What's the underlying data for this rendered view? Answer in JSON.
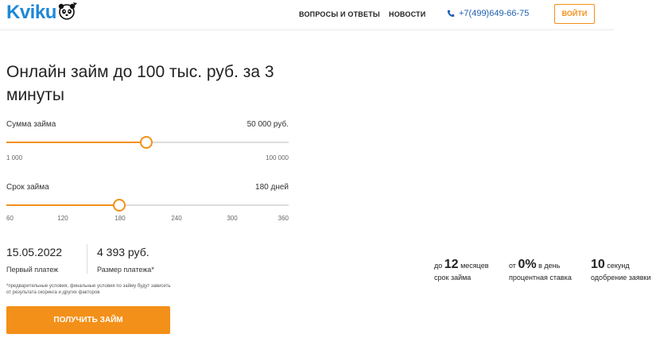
{
  "header": {
    "logo_text": "Kviku",
    "nav": [
      {
        "label": "ВОПРОСЫ И ОТВЕТЫ"
      },
      {
        "label": "НОВОСТИ"
      }
    ],
    "phone": "+7(499)649-66-75",
    "login_label": "ВОЙТИ"
  },
  "main": {
    "title": "Онлайн займ до 100 тыс. руб. за 3 минуты",
    "amount": {
      "label": "Сумма займа",
      "value_text": "50 000 руб.",
      "min_text": "1 000",
      "max_text": "100 000",
      "min": 1000,
      "max": 100000,
      "value": 50000
    },
    "term": {
      "label": "Срок займа",
      "value_text": "180 дней",
      "ticks": [
        "60",
        "120",
        "180",
        "240",
        "300",
        "360"
      ],
      "min": 60,
      "max": 360,
      "value": 180
    },
    "result": {
      "date": "15.05.2022",
      "date_caption": "Первый платеж",
      "payment": "4 393 руб.",
      "payment_caption": "Размер платежа*"
    },
    "disclaimer": "*предварительные условия, финальные условия по займу будут зависеть от результата скоринга и других факторов",
    "cta_label": "ПОЛУЧИТЬ ЗАЙМ"
  },
  "features": [
    {
      "prefix": "до",
      "big": "12",
      "suffix": "месяцев",
      "caption": "срок займа"
    },
    {
      "prefix": "от",
      "big": "0%",
      "suffix": "в день",
      "caption": "процентная ставка"
    },
    {
      "prefix": "",
      "big": "10",
      "suffix": "секунд",
      "caption": "одобрение заявки"
    }
  ],
  "colors": {
    "accent": "#f39019",
    "brand_blue": "#1e88d8",
    "phone_blue": "#1f5fb0",
    "track": "#dcdcdc"
  },
  "icons": [
    "panda-logo-icon",
    "phone-icon"
  ]
}
